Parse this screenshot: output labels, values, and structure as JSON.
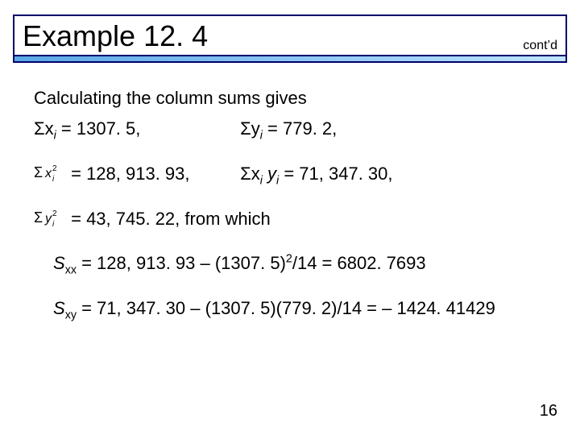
{
  "title": "Example 12. 4",
  "contd": "cont’d",
  "body": {
    "line1": "Calculating the column sums gives",
    "sum_xi": "Σx",
    "sum_xi_val": " = 1307. 5,",
    "sum_yi": "Σy",
    "sum_yi_val": " = 779. 2,",
    "sum_xi2_val": " = 128, 913. 93,",
    "sum_xiyi": "Σx",
    "sum_xiyi_mid": " y",
    "sum_xiyi_val": " = 71, 347. 30,",
    "sum_yi2_val": " = 43, 745. 22, from which",
    "sxx_label": "S",
    "sxx_val": " = 128, 913. 93 – (1307. 5)",
    "sxx_tail": "/14 = 6802. 7693",
    "sxy_label": "S",
    "sxy_val": " = 71, 347. 30 – (1307. 5)(779. 2)/14 = – 1424. 41429",
    "i": "i",
    "xx": "xx",
    "xy": "xy",
    "sq": "2"
  },
  "pagenum": "16"
}
